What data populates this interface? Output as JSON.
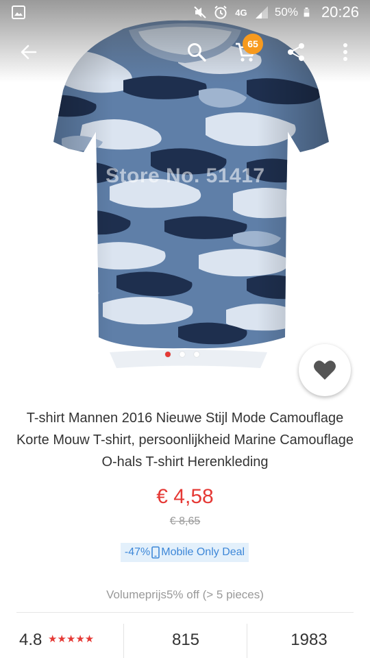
{
  "status_bar": {
    "network_type": "4G",
    "battery_percent": "50%",
    "time": "20:26"
  },
  "product_image": {
    "watermark": "Store No. 51417"
  },
  "action_bar": {
    "cart_count": "65"
  },
  "pager": {
    "count": 3,
    "active_index": 0
  },
  "product": {
    "title": "T-shirt Mannen 2016 Nieuwe Stijl Mode Camouflage Korte Mouw T-shirt, persoonlijkheid Marine Camouflage O-hals T-shirt Herenkleding",
    "price": "€ 4,58",
    "original_price": "€ 8,65",
    "deal_discount": "-47%",
    "deal_text": "Mobile Only Deal",
    "volume_pricing": "Volumeprijs5% off (> 5 pieces)"
  },
  "stats": {
    "rating": "4.8",
    "stars": "★★★★★",
    "orders": "815",
    "wishes": "1983"
  },
  "colors": {
    "accent_red": "#e53935",
    "badge_orange": "#f79a1e",
    "deal_blue": "#3d87d8",
    "deal_bg": "#e3f0fb"
  },
  "icons": {
    "status": [
      "gallery-icon",
      "mute-icon",
      "alarm-icon",
      "signal-icon",
      "battery-icon"
    ],
    "action_bar": [
      "back-arrow-icon",
      "search-icon",
      "cart-icon",
      "share-icon",
      "more-vert-icon"
    ],
    "wishlist": "heart-icon",
    "deal": "phone-icon"
  }
}
